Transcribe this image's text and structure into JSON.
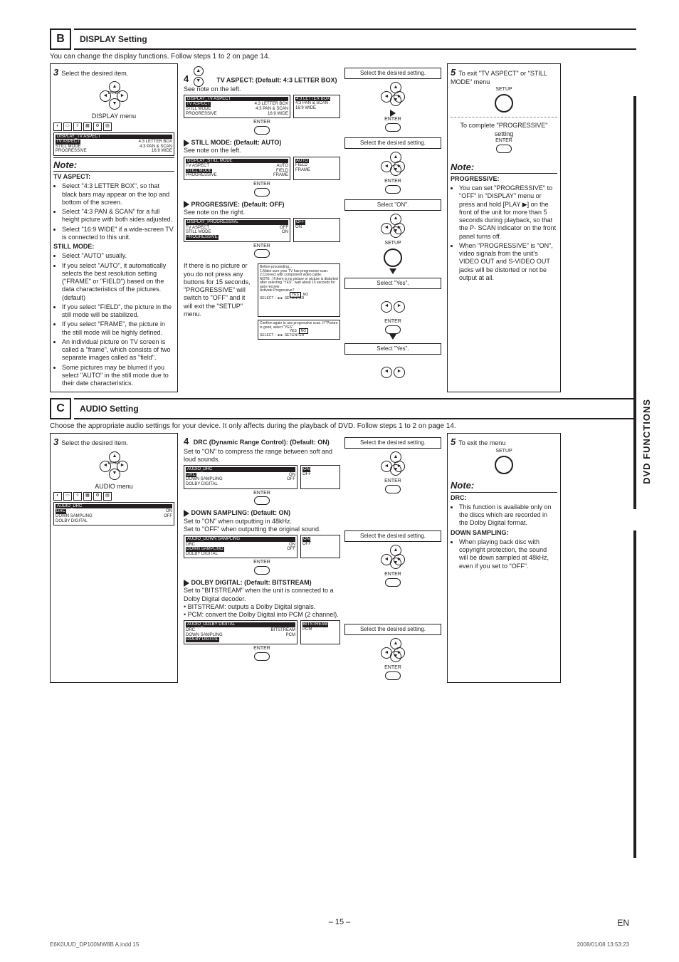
{
  "side_tab": "DVD FUNCTIONS",
  "sectB": {
    "letter": "B",
    "title": "DISPLAY Setting",
    "intro": "You can change the display functions. Follow steps 1 to 2 on page 14.",
    "step3": {
      "num": "3",
      "text": "Select the desired item."
    },
    "display_menu_label": "DISPLAY menu",
    "menu": {
      "header": "DISPLAY_TV ASPECT",
      "rows": [
        {
          "l": "TV ASPECT",
          "r": "4:3 LETTER BOX"
        },
        {
          "l": "STILL MODE",
          "r": "4:3 PAN & SCAN"
        },
        {
          "l": "PROGRESSIVE",
          "r": "16:9 WIDE"
        }
      ]
    },
    "note": {
      "title": "Note:",
      "tv_aspect_hd": "TV ASPECT:",
      "tv_aspect": [
        "Select \"4:3 LETTER BOX\", so that black bars may appear on the top and bottom of the screen.",
        "Select \"4:3 PAN & SCAN\" for a full height picture with both sides adjusted.",
        "Select \"16:9 WIDE\" if a wide-screen TV is connected to this unit."
      ],
      "still_hd": "STILL MODE:",
      "still": [
        "Select \"AUTO\" usually.",
        "If you select \"AUTO\", it automatically selects the best resolution setting (\"FRAME\" or \"FIELD\") based on the data characteristics of the pictures. (default)",
        "If you select \"FIELD\", the picture in the still mode will be stabilized.",
        "If you select \"FRAME\", the picture in the still mode will be highly defined.",
        "An individual picture on TV screen is called a \"frame\", which consists of two separate images called as \"field\".",
        "Some pictures may be blurred if you select \"AUTO\" in the still mode due to their date characteristics."
      ]
    },
    "tv_aspect": {
      "heading": "TV ASPECT: (Default: 4:3 LETTER BOX)",
      "sub": "See note on the left.",
      "screen_hdr": "DISPLAY_TV ASPECT",
      "rows": [
        {
          "l": "TV ASPECT",
          "r": "4:3 LETTER BOX",
          "r2": "4:3 LETTER BOX"
        },
        {
          "l": "STILL MODE",
          "r": "4:3 PAN & SCAN",
          "r2": "4:3 PAN & SCAN"
        },
        {
          "l": "PROGRESSIVE",
          "r": "16:9 WIDE",
          "r2": "16:9 WIDE"
        }
      ]
    },
    "still_mode": {
      "heading": "STILL MODE: (Default: AUTO)",
      "sub": "See note on the left.",
      "screen_hdr": "DISPLAY_STILL MODE",
      "rows": [
        {
          "l": "TV ASPECT",
          "r": "AUTO",
          "r2": "AUTO"
        },
        {
          "l": "STILL MODE",
          "r": "FIELD",
          "r2": "FIELD"
        },
        {
          "l": "PROGRESSIVE",
          "r": "FRAME",
          "r2": "FRAME"
        }
      ]
    },
    "progressive": {
      "heading": "PROGRESSIVE: (Default: OFF)",
      "sub": "See note on the right.",
      "screen_hdr": "DISPLAY_PROGRESSIVE",
      "rows": [
        {
          "l": "TV ASPECT",
          "r": "OFF",
          "r2": "OFF"
        },
        {
          "l": "STILL MODE",
          "r": "ON",
          "r2": "ON"
        },
        {
          "l": "PROGRESSIVE",
          "r": "",
          "r2": ""
        }
      ],
      "no_picture": "If there is no picture or you do not press any buttons for 15 seconds, \"PROGRESSIVE\" will switch to \"OFF\" and it will exit the \"SETUP\" menu.",
      "before_hdr": "Before proceeding...",
      "before_lines": [
        "1.Make sure your TV has progressive scan.",
        "2.Connect with component video cable.",
        "NOTE : If there is no picture or picture is distorted after selecting \"YES\", wait about 15 seconds for auto recover."
      ],
      "activate": "Activate Progressive?",
      "yes": "YES",
      "no": "NO",
      "select_setenter": "SELECT : ◄►    SET:ENTER",
      "confirm": "Confirm again to use progressive scan. If \"Picture is good, select \"YES\"."
    },
    "select_on": "Select \"ON\".",
    "select_yes": "Select \"Yes\".",
    "select_desired": "Select the desired setting.",
    "enter_lbl": "ENTER",
    "setup_lbl": "SETUP",
    "step4_arrows": "▲/▼",
    "step5": {
      "num": "5",
      "exit": "To exit \"TV ASPECT\" or \"STILL MODE\" menu",
      "complete": "To complete \"PROGRESSIVE\" setting"
    },
    "note_right": {
      "title": "Note:",
      "hd": "PROGRESSIVE:",
      "items": [
        "You can set \"PROGRESSIVE\" to \"OFF\" in \"DISPLAY\" menu or press and hold [PLAY ▶] on the front of the unit for more than 5 seconds during playback, so that the P- SCAN indicator on the front panel turns off.",
        "When \"PROGRESSIVE\" is \"ON\", video signals from the unit's VIDEO OUT and S-VIDEO OUT jacks will be distorted or not be output at all."
      ]
    }
  },
  "sectC": {
    "letter": "C",
    "title": "AUDIO Setting",
    "intro": "Choose the appropriate audio settings for your device. It only affects during the playback of DVD. Follow steps 1 to 2 on page 14.",
    "step3": {
      "num": "3",
      "text": "Select the desired item."
    },
    "audio_menu_label": "AUDIO menu",
    "menu": {
      "header": "AUDIO_DRC",
      "rows": [
        {
          "l": "DRC",
          "r": "ON"
        },
        {
          "l": "DOWN SAMPLING",
          "r": "OFF"
        },
        {
          "l": "DOLBY DIGITAL",
          "r": ""
        }
      ]
    },
    "drc": {
      "heading": "DRC (Dynamic Range Control): (Default: ON)",
      "desc": "Set to \"ON\" to compress the range between soft and loud sounds.",
      "screen_hdr": "AUDIO_DRC",
      "rows": [
        {
          "l": "DRC",
          "r": "ON",
          "r2": "ON"
        },
        {
          "l": "DOWN SAMPLING",
          "r": "OFF",
          "r2": "OFF"
        },
        {
          "l": "DOLBY DIGITAL",
          "r": "",
          "r2": ""
        }
      ]
    },
    "down": {
      "heading": "DOWN SAMPLING: (Default: ON)",
      "desc1": "Set to \"ON\" when outputting in 48kHz.",
      "desc2": "Set to \"OFF\" when outputting the original sound.",
      "screen_hdr": "AUDIO_DOWN SAMPLING",
      "rows": [
        {
          "l": "DRC",
          "r": "ON",
          "r2": "ON"
        },
        {
          "l": "DOWN SAMPLING",
          "r": "OFF",
          "r2": "OFF"
        },
        {
          "l": "DOLBY DIGITAL",
          "r": "",
          "r2": ""
        }
      ]
    },
    "dolby": {
      "heading": "DOLBY DIGITAL: (Default: BITSTREAM)",
      "desc": "Set to \"BITSTREAM\" when the unit is connected to a Dolby Digital decoder.",
      "b1": "BITSTREAM: outputs a Dolby Digital signals.",
      "b2": "PCM: convert the Dolby Digital into PCM (2 channel).",
      "screen_hdr": "AUDIO_DOLBY DIGITAL",
      "rows": [
        {
          "l": "DRC",
          "r": "BITSTREAM",
          "r2": "BITSTREAM"
        },
        {
          "l": "DOWN SAMPLING",
          "r": "PCM",
          "r2": "PCM"
        },
        {
          "l": "DOLBY DIGITAL",
          "r": "",
          "r2": ""
        }
      ]
    },
    "select_desired": "Select the desired setting.",
    "enter_lbl": "ENTER",
    "setup_lbl": "SETUP",
    "step5": {
      "num": "5",
      "text": "To exit the menu"
    },
    "note_right": {
      "title": "Note:",
      "drc_hd": "DRC:",
      "drc": "This function is available only on the discs which are recorded in the Dolby Digital format.",
      "down_hd": "DOWN SAMPLING:",
      "down": "When playing back disc with copyright protection, the sound will be down sampled at 48kHz, even if you set to \"OFF\"."
    }
  },
  "footer": {
    "page": "– 15 –",
    "en": "EN"
  },
  "meta": {
    "file": "E6K0UUD_DP100MW8B A.indd   15",
    "ts": "2008/01/08   13:53:23"
  }
}
